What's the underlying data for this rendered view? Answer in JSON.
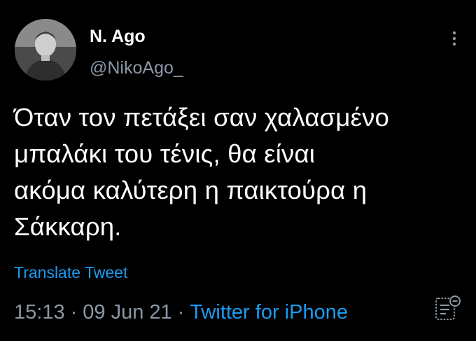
{
  "user": {
    "display_name": "N. Ago",
    "handle": "@NikoAgo_"
  },
  "tweet": {
    "lines": [
      "Όταν τον πετάξει σαν χαλασμένο",
      "μπαλάκι του τένις, θα είναι",
      "ακόμα καλύτερη η παικτούρα η",
      "Σάκκαρη."
    ],
    "translate_label": "Translate Tweet",
    "time": "15:13",
    "separator": "·",
    "date": "09 Jun 21",
    "source": "Twitter for iPhone"
  },
  "icons": {
    "more": "vertical-ellipsis-icon",
    "analytics": "tweet-analytics-icon"
  },
  "colors": {
    "background": "#000000",
    "text": "#ffffff",
    "secondary": "#8b98a5",
    "link": "#1d9bf0"
  }
}
